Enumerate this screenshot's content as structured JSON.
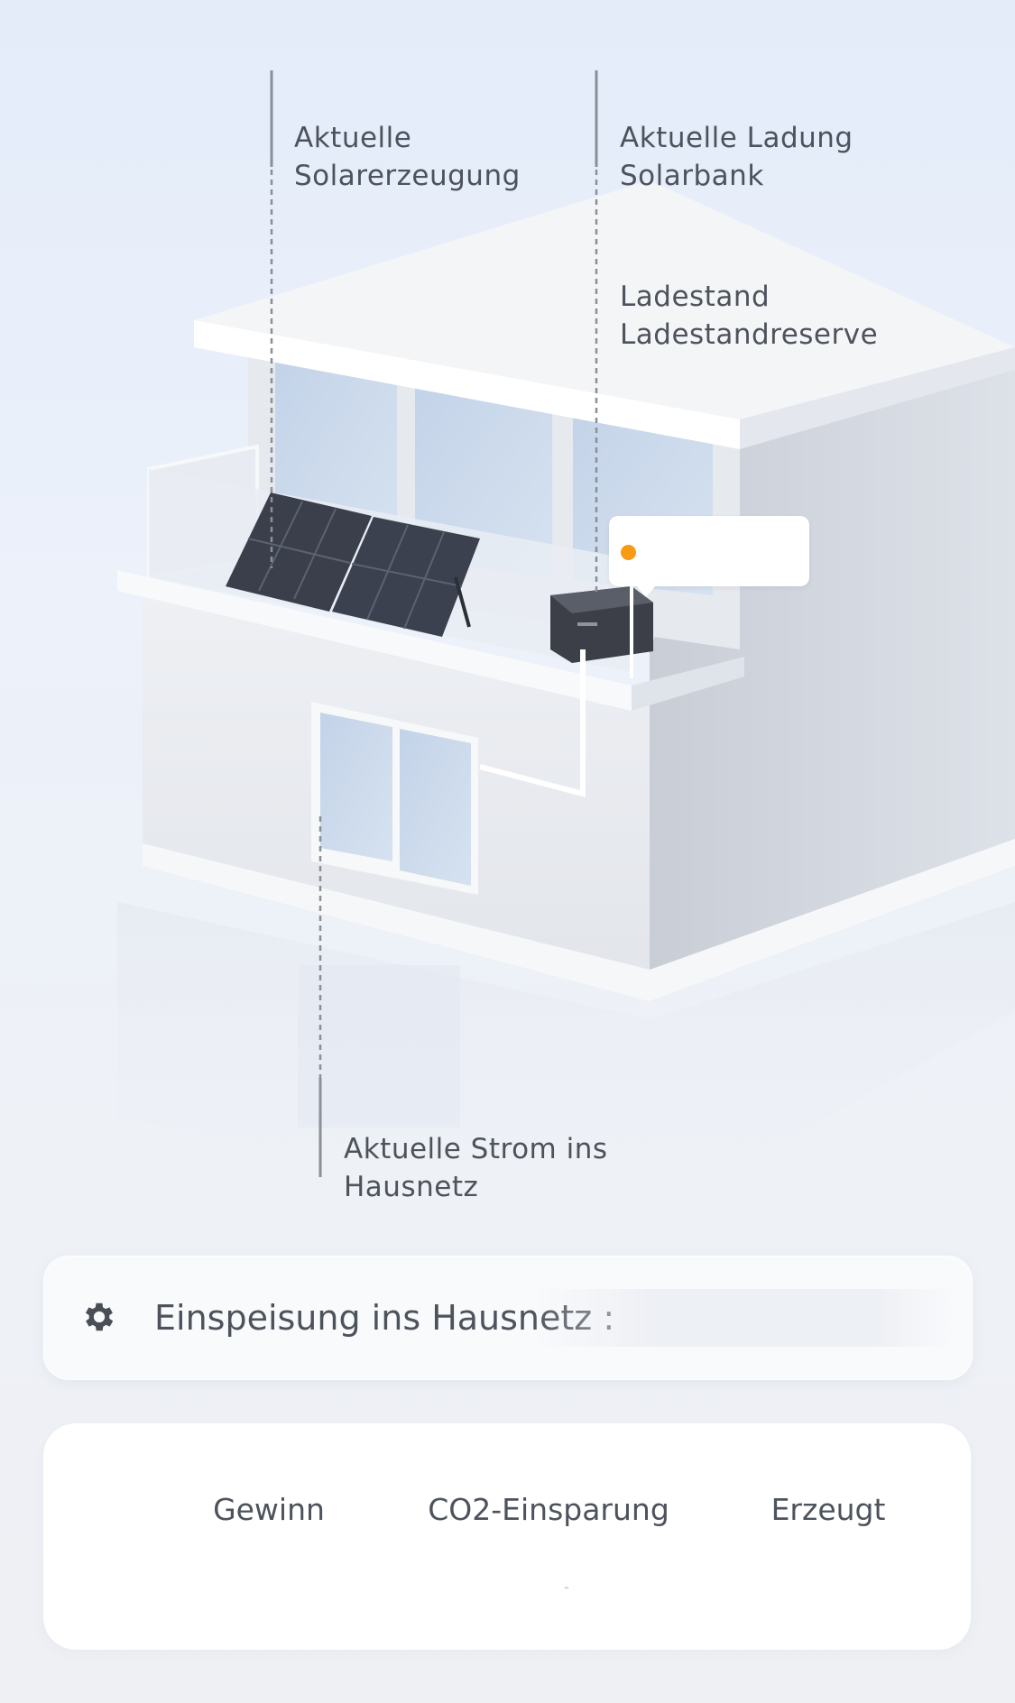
{
  "labels": {
    "solar": [
      "Aktuelle",
      "Solarerzeugung"
    ],
    "charge": [
      "Aktuelle Ladung",
      "Solarbank"
    ],
    "soc": [
      "Ladestand",
      "Ladestandreserve"
    ],
    "grid": [
      "Aktuelle Strom ins",
      "Hausnetz"
    ]
  },
  "device_status": {
    "indicator_color": "#f79a14",
    "value": ""
  },
  "feed_in": {
    "icon": "gear-icon",
    "label": "Einspeisung ins Hausnetz :",
    "value": ""
  },
  "stats": [
    {
      "label": "Gewinn",
      "value": ""
    },
    {
      "label": "CO2-Einsparung",
      "value": "-"
    },
    {
      "label": "Erzeugt",
      "value": ""
    }
  ],
  "colors": {
    "background": "#e8eef9",
    "accent_orange": "#f79a14",
    "text": "#4d535c",
    "card": "#ffffff"
  }
}
